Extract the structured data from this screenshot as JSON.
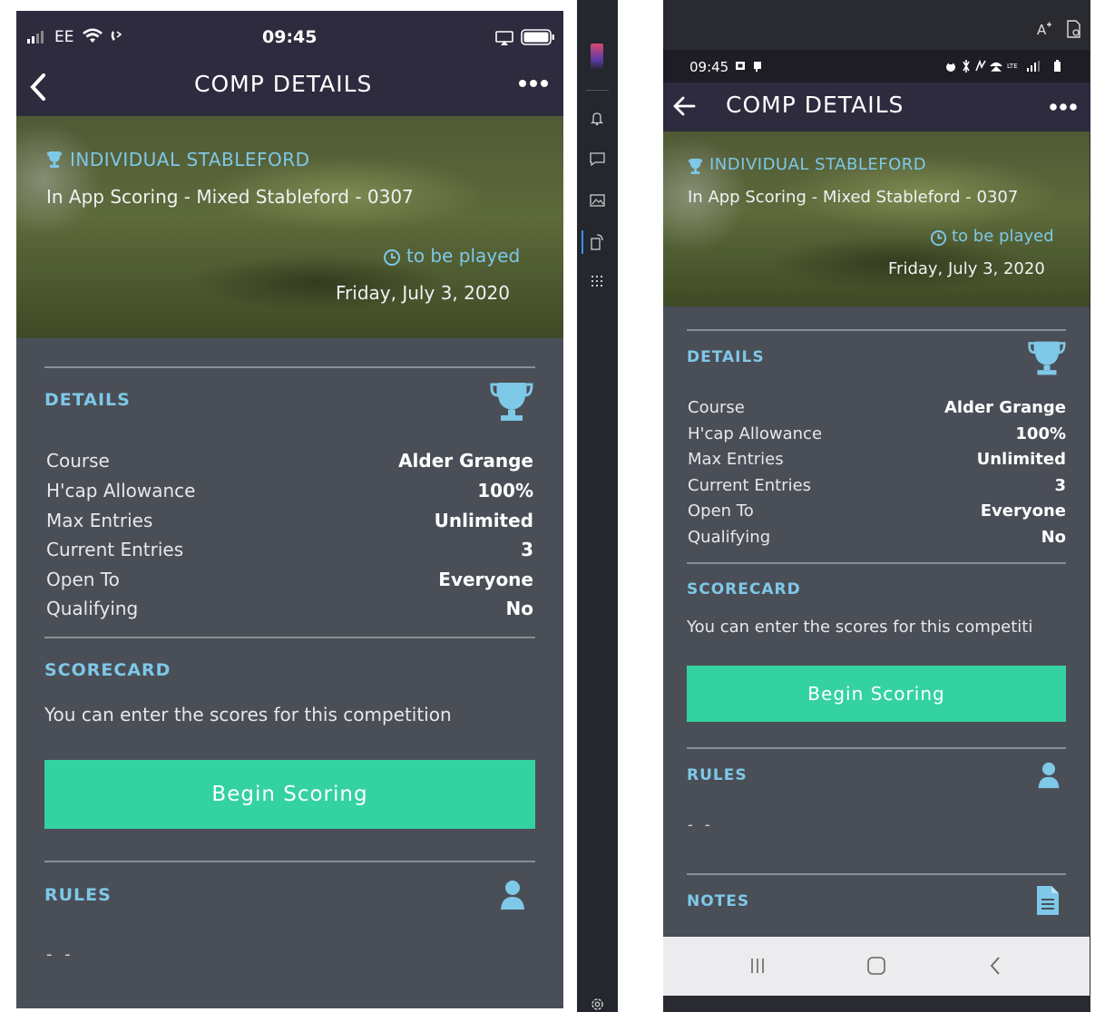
{
  "ios": {
    "status": {
      "carrier": "EE",
      "time": "09:45"
    },
    "header": {
      "title": "COMP DETAILS"
    },
    "hero": {
      "type_label": "INDIVIDUAL STABLEFORD",
      "comp_name": "In App Scoring - Mixed Stableford - 0307",
      "status": "to be played",
      "date": "Friday, July 3, 2020"
    },
    "details": {
      "label": "DETAILS",
      "rows": [
        {
          "label": "Course",
          "value": "Alder Grange"
        },
        {
          "label": "H'cap Allowance",
          "value": "100%"
        },
        {
          "label": "Max Entries",
          "value": "Unlimited"
        },
        {
          "label": "Current Entries",
          "value": "3"
        },
        {
          "label": "Open To",
          "value": "Everyone"
        },
        {
          "label": "Qualifying",
          "value": "No"
        }
      ]
    },
    "scorecard": {
      "label": "SCORECARD",
      "text": "You can enter the scores for this competition",
      "button": "Begin Scoring"
    },
    "rules": {
      "label": "RULES",
      "text": "- -"
    }
  },
  "android": {
    "status": {
      "time": "09:45"
    },
    "header": {
      "title": "COMP DETAILS"
    },
    "hero": {
      "type_label": "INDIVIDUAL STABLEFORD",
      "comp_name": "In App Scoring - Mixed Stableford - 0307",
      "status": "to be played",
      "date": "Friday, July 3, 2020"
    },
    "details": {
      "label": "DETAILS",
      "rows": [
        {
          "label": "Course",
          "value": "Alder Grange"
        },
        {
          "label": "H'cap Allowance",
          "value": "100%"
        },
        {
          "label": "Max Entries",
          "value": "Unlimited"
        },
        {
          "label": "Current Entries",
          "value": "3"
        },
        {
          "label": "Open To",
          "value": "Everyone"
        },
        {
          "label": "Qualifying",
          "value": "No"
        }
      ]
    },
    "scorecard": {
      "label": "SCORECARD",
      "text": "You can enter the scores for this competiti",
      "button": "Begin Scoring"
    },
    "rules": {
      "label": "RULES",
      "text": "- -"
    },
    "notes": {
      "label": "NOTES"
    }
  },
  "colors": {
    "accent": "#7ec8e8",
    "button": "#34d2a0",
    "header_bg": "#2e2b3e",
    "panel_bg": "#4a4e57"
  },
  "icons": [
    "back-chevron-icon",
    "more-icon",
    "trophy-icon",
    "clock-icon",
    "person-icon",
    "document-icon",
    "wifi-icon",
    "battery-icon",
    "airplay-icon",
    "back-arrow-icon",
    "bell-icon",
    "chat-icon",
    "image-icon",
    "rotate-icon",
    "grid-icon",
    "settings-icon",
    "recents-icon",
    "home-icon",
    "nav-back-icon",
    "font-size-icon",
    "screen-capture-icon"
  ]
}
